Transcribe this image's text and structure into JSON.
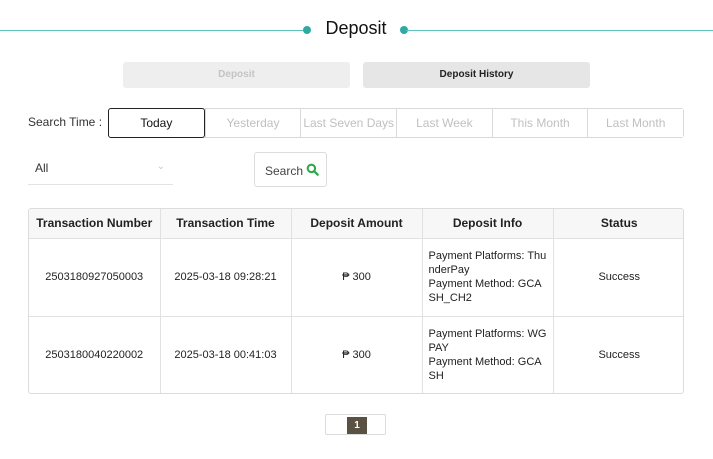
{
  "page": {
    "title": "Deposit"
  },
  "tabs": {
    "deposit_label": "Deposit",
    "history_label": "Deposit History"
  },
  "filters": {
    "search_time_label": "Search Time :",
    "time_options": [
      "Today",
      "Yesterday",
      "Last Seven Days",
      "Last Week",
      "This Month",
      "Last Month"
    ],
    "active_time": "Today",
    "status_select_value": "All",
    "search_button_label": "Search"
  },
  "table": {
    "headers": [
      "Transaction Number",
      "Transaction Time",
      "Deposit Amount",
      "Deposit Info",
      "Status"
    ],
    "rows": [
      {
        "transaction_number": "2503180927050003",
        "transaction_time": "2025-03-18 09:28:21",
        "deposit_amount": "₱ 300",
        "info_line1": "Payment Platforms: ThunderPay",
        "info_line2": "Payment Method: GCASH_CH2",
        "status": "Success"
      },
      {
        "transaction_number": "2503180040220002",
        "transaction_time": "2025-03-18 00:41:03",
        "deposit_amount": "₱ 300",
        "info_line1": "Payment Platforms: WGPAY",
        "info_line2": "Payment Method: GCASH",
        "status": "Success"
      }
    ]
  },
  "pagination": {
    "current_page": "1"
  },
  "colors": {
    "accent_teal": "#2eaaa3",
    "page_active": "#5b5143",
    "search_icon": "#2ea84a"
  },
  "icons": {
    "search": "search-icon",
    "select_chevron": "chevron-down-icon"
  }
}
